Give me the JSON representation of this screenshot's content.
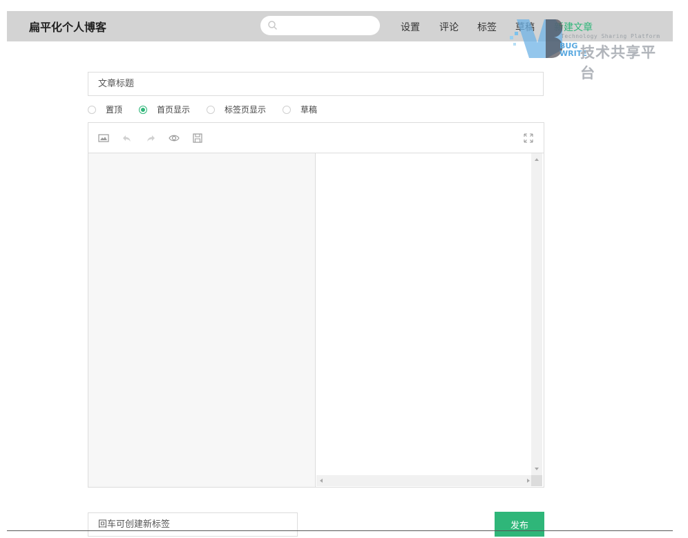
{
  "header": {
    "site_title": "扁平化个人博客",
    "nav": [
      "设置",
      "评论",
      "标签",
      "草稿",
      "新建文章"
    ],
    "search_icon": "search-icon"
  },
  "watermark": {
    "line1": "Technology Sharing Platform",
    "line2": "技术共享平台",
    "bug": "BUG",
    "write": "WRITE"
  },
  "form": {
    "title_placeholder": "文章标题",
    "options": [
      "置顶",
      "首页显示",
      "标签页显示",
      "草稿"
    ],
    "selected_option": "首页显示",
    "tag_placeholder": "回车可创建新标签",
    "publish_label": "发布"
  },
  "toolbar_icons": [
    "image-icon",
    "undo-icon",
    "redo-icon",
    "preview-eye-icon",
    "save-icon",
    "fullscreen-icon"
  ],
  "colors": {
    "accent": "#2fb679",
    "header_bg": "#d3d3d3"
  }
}
